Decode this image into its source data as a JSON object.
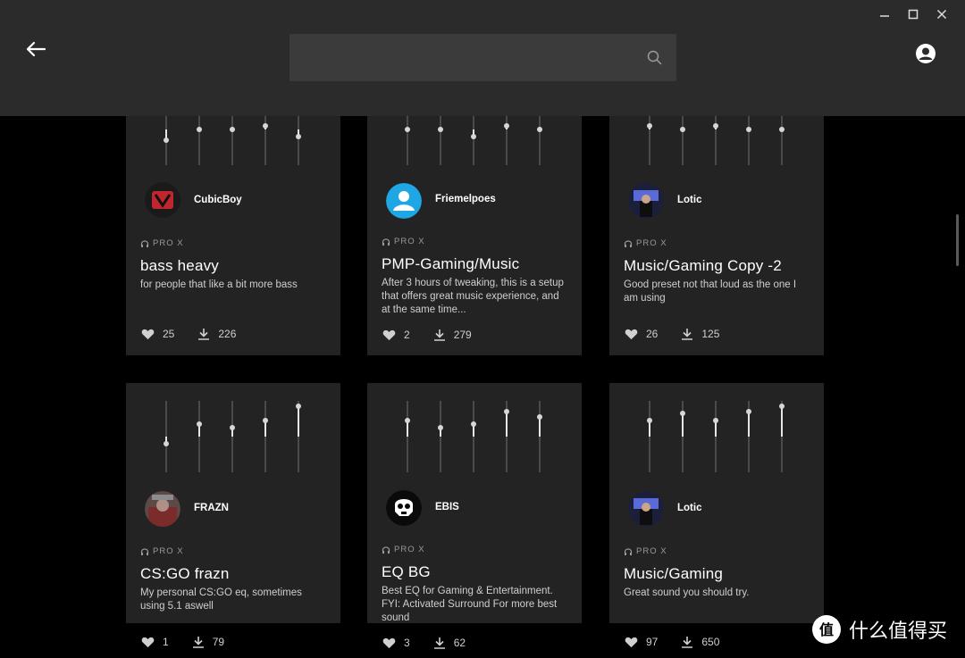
{
  "header": {
    "search": {
      "value": "",
      "placeholder": ""
    }
  },
  "icons": {
    "back": "arrow-left-icon",
    "search": "search-icon",
    "profile": "user-circle-icon",
    "minimize": "minimize-icon",
    "maximize": "maximize-icon",
    "close": "close-icon",
    "device": "headset-icon",
    "like": "heart-icon",
    "download": "download-icon"
  },
  "cards": [
    {
      "username": "CubicBoy",
      "device": "PRO X",
      "title": "bass heavy",
      "description": "for people that like a bit more bass",
      "likes": "25",
      "downloads": "226",
      "eq": [
        0.35,
        0.5,
        0.5,
        0.55,
        0.4
      ]
    },
    {
      "username": "Friemelpoes",
      "device": "PRO X",
      "title": "PMP-Gaming/Music",
      "description": "After 3 hours of tweaking, this is a setup that offers great music experience, and at the same time...",
      "likes": "2",
      "downloads": "279",
      "eq": [
        0.5,
        0.5,
        0.4,
        0.55,
        0.5
      ]
    },
    {
      "username": "Lotic",
      "device": "PRO X",
      "title": "Music/Gaming Copy -2",
      "description": "Good preset not that loud as the one I am using",
      "likes": "26",
      "downloads": "125",
      "eq": [
        0.55,
        0.5,
        0.55,
        0.5,
        0.5
      ]
    },
    {
      "username": "FRAZN",
      "device": "PRO X",
      "title": "CS:GO frazn",
      "description": "My personal CS:GO eq, sometimes using 5.1 aswell",
      "likes": "1",
      "downloads": "79",
      "eq": [
        0.4,
        0.67,
        0.63,
        0.72,
        0.92
      ]
    },
    {
      "username": "EBIS",
      "device": "PRO X",
      "title": "EQ BG",
      "description": "Best EQ for Gaming & Entertainment. FYI: Activated Surround For more best sound",
      "likes": "3",
      "downloads": "62",
      "eq": [
        0.73,
        0.63,
        0.67,
        0.85,
        0.77
      ]
    },
    {
      "username": "Lotic",
      "device": "PRO X",
      "title": "Music/Gaming",
      "description": "Great sound you should try.",
      "likes": "97",
      "downloads": "650",
      "eq": [
        0.73,
        0.83,
        0.73,
        0.85,
        0.92
      ]
    }
  ],
  "watermark": {
    "text": "什么值得买",
    "logo_symbol": "值"
  },
  "colors": {
    "header_bg": "#2b2b2b",
    "card_bg": "#232323",
    "page_bg": "#000000",
    "search_bg": "#3b3b3b"
  }
}
